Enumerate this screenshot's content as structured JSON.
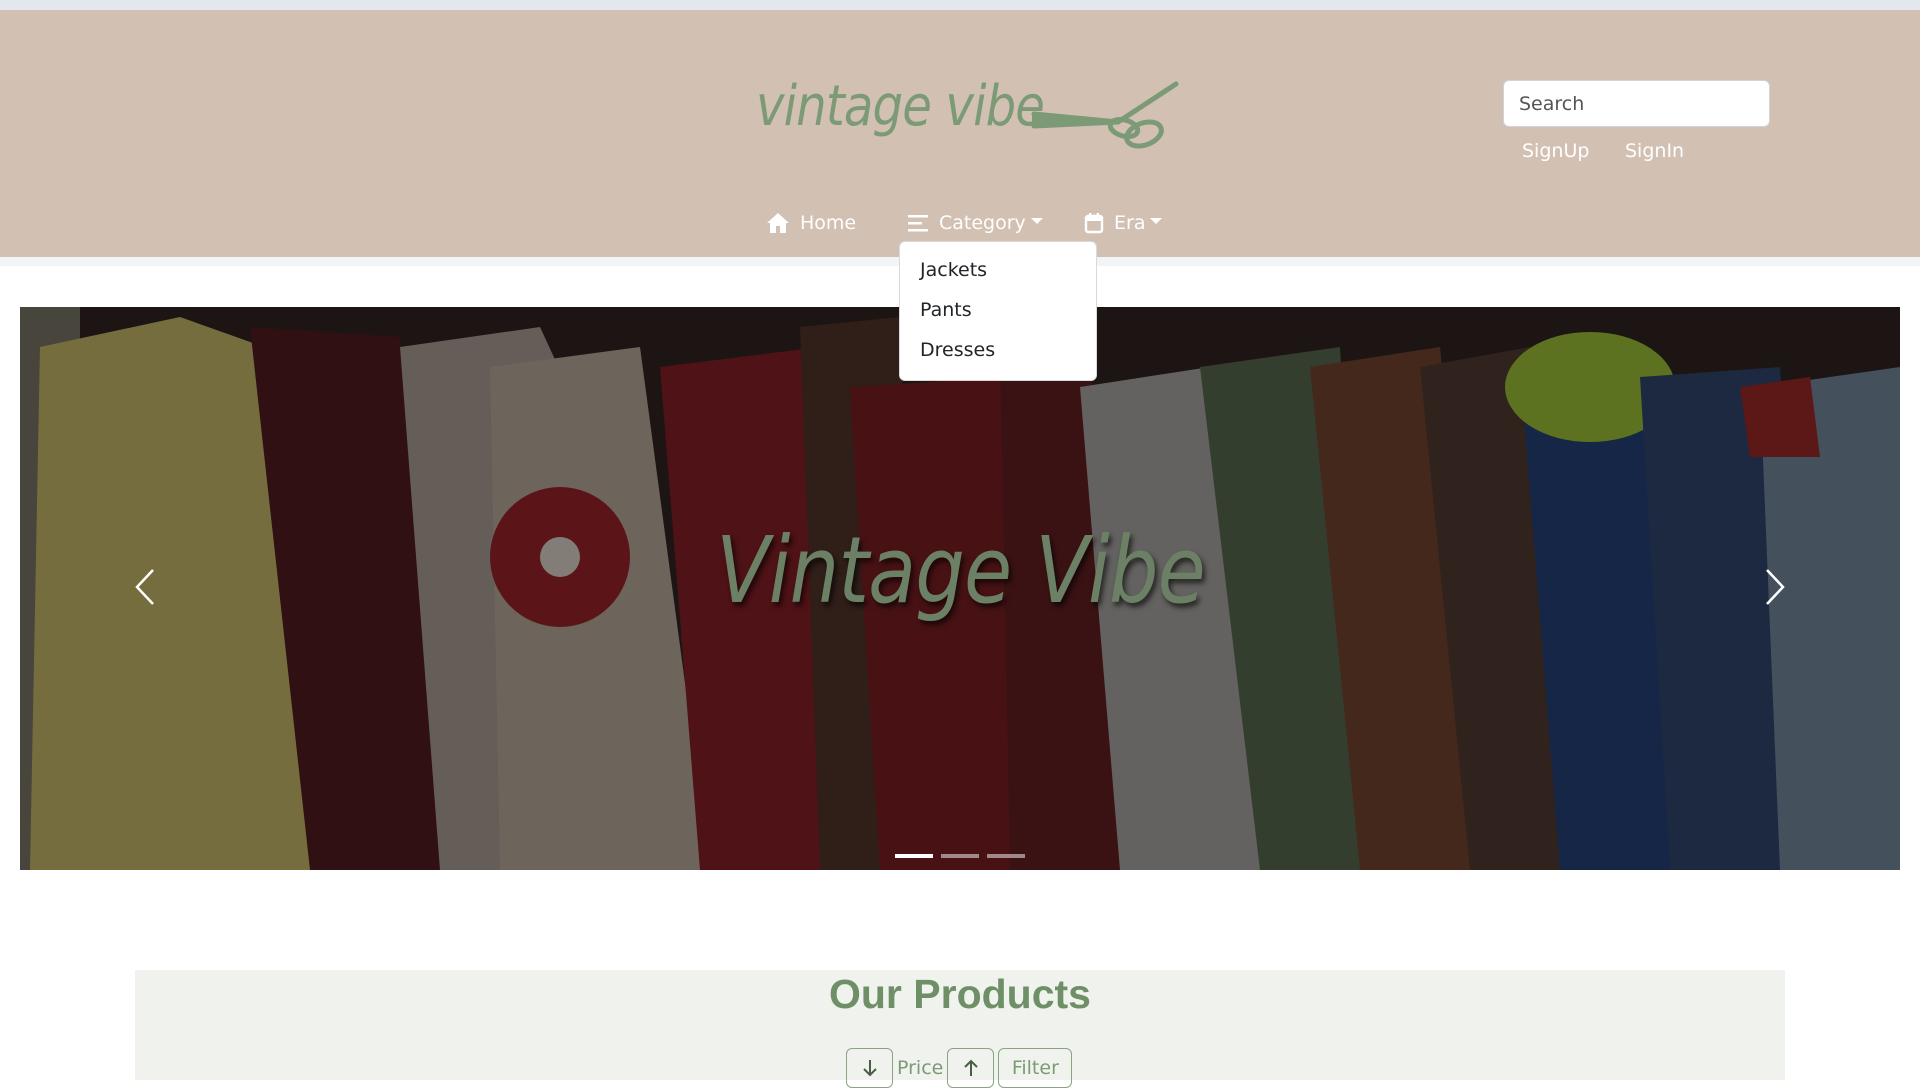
{
  "header": {
    "logo_text": "vintage vibe",
    "search": {
      "placeholder": "Search",
      "value": ""
    },
    "auth": {
      "signup_label": "SignUp",
      "signin_label": "SignIn"
    },
    "nav": {
      "home_label": "Home",
      "category_label": "Category",
      "era_label": "Era"
    },
    "category_dropdown": {
      "open": true,
      "items": [
        "Jackets",
        "Pants",
        "Dresses"
      ]
    }
  },
  "carousel": {
    "caption": "Vintage Vibe",
    "slide_count": 3,
    "active_slide": 1
  },
  "products": {
    "title": "Our Products",
    "price_label": "Price",
    "filter_label": "Filter"
  },
  "colors": {
    "header_bg": "#d2c0b3",
    "brand_green": "#7c9a76",
    "products_bg": "#f0f2ee"
  },
  "icons": {
    "logo": "scissors-icon",
    "home": "home-icon",
    "category": "menu-lines-icon",
    "era": "calendar-icon",
    "prev": "chevron-left-icon",
    "next": "chevron-right-icon",
    "sort_desc": "arrow-down-icon",
    "sort_asc": "arrow-up-icon"
  }
}
